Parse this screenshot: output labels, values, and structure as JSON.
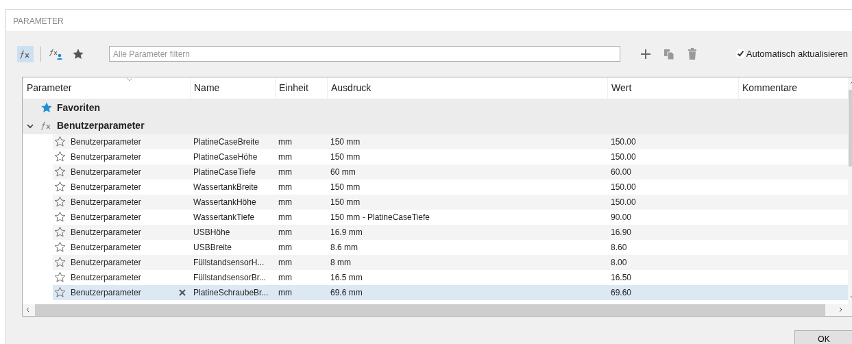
{
  "window": {
    "title": "PARAMETER"
  },
  "toolbar": {
    "fx_toggle_selected": true,
    "filter": {
      "placeholder": "Alle Parameter filtern"
    },
    "auto_update": {
      "label": "Automatisch aktualisieren",
      "checked": true
    }
  },
  "table": {
    "columns": [
      "Parameter",
      "Name",
      "Einheit",
      "Ausdruck",
      "Wert",
      "Kommentare"
    ],
    "groups": [
      {
        "kind": "favorites",
        "label": "Favoriten"
      },
      {
        "kind": "user",
        "label": "Benutzerparameter",
        "expanded": true,
        "rows": [
          {
            "parameter": "Benutzerparameter",
            "name": "PlatineCaseBreite",
            "unit": "mm",
            "expression": "150 mm",
            "value": "150.00",
            "selected": false
          },
          {
            "parameter": "Benutzerparameter",
            "name": "PlatineCaseHöhe",
            "unit": "mm",
            "expression": "150 mm",
            "value": "150.00",
            "selected": false
          },
          {
            "parameter": "Benutzerparameter",
            "name": "PlatineCaseTiefe",
            "unit": "mm",
            "expression": "60 mm",
            "value": "60.00",
            "selected": false
          },
          {
            "parameter": "Benutzerparameter",
            "name": "WassertankBreite",
            "unit": "mm",
            "expression": "150 mm",
            "value": "150.00",
            "selected": false
          },
          {
            "parameter": "Benutzerparameter",
            "name": "WassertankHöhe",
            "unit": "mm",
            "expression": "150 mm",
            "value": "150.00",
            "selected": false
          },
          {
            "parameter": "Benutzerparameter",
            "name": "WassertankTiefe",
            "unit": "mm",
            "expression": "150 mm - PlatineCaseTiefe",
            "value": "90.00",
            "selected": false
          },
          {
            "parameter": "Benutzerparameter",
            "name": "USBHöhe",
            "unit": "mm",
            "expression": "16.9 mm",
            "value": "16.90",
            "selected": false
          },
          {
            "parameter": "Benutzerparameter",
            "name": "USBBreite",
            "unit": "mm",
            "expression": "8.6 mm",
            "value": "8.60",
            "selected": false
          },
          {
            "parameter": "Benutzerparameter",
            "name": "FüllstandsensorH...",
            "unit": "mm",
            "expression": "8 mm",
            "value": "8.00",
            "selected": false
          },
          {
            "parameter": "Benutzerparameter",
            "name": "FüllstandsensorBr...",
            "unit": "mm",
            "expression": "16.5 mm",
            "value": "16.50",
            "selected": false
          },
          {
            "parameter": "Benutzerparameter",
            "name": "PlatineSchraubeBr...",
            "unit": "mm",
            "expression": "69.6 mm",
            "value": "69.60",
            "selected": true
          }
        ]
      }
    ]
  },
  "buttons": [
    "OK"
  ]
}
